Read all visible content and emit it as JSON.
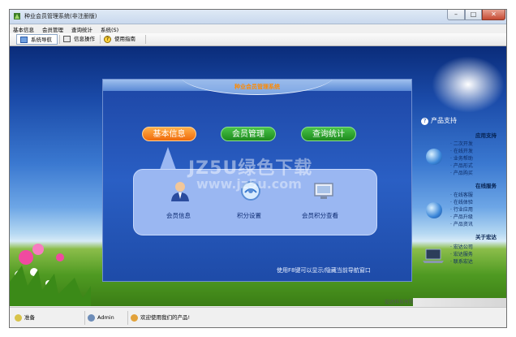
{
  "window": {
    "title": "种业会员管理系统(非注册版)",
    "controls": {
      "minimize": "–",
      "maximize": "□",
      "close": "✕"
    }
  },
  "menu": [
    "基本信息",
    "会员管理",
    "查询统计",
    "系统(S)"
  ],
  "toolbar": {
    "items": [
      {
        "label": "系统导航",
        "icon": "monitor-icon",
        "selected": true
      },
      {
        "label": "信息操作",
        "icon": "window-icon",
        "selected": false
      },
      {
        "label": "使用指南",
        "icon": "help-icon",
        "selected": false
      }
    ]
  },
  "nav_panel": {
    "title": "种业会员管理系统",
    "buttons": [
      {
        "label": "基本信息",
        "color": "#f07a10"
      },
      {
        "label": "会员管理",
        "color": "#28a028"
      },
      {
        "label": "查询统计",
        "color": "#28a028"
      }
    ],
    "sub_items": [
      {
        "label": "会员信息",
        "icon": "user-icon"
      },
      {
        "label": "积分设置",
        "icon": "globe-gear-icon"
      },
      {
        "label": "会员积分查看",
        "icon": "screen-icon"
      }
    ],
    "hint": "使用F8键可以显示/隐藏当前导航窗口"
  },
  "watermark": {
    "line1": "JZ5U绿色下载",
    "line2": "www.jz5u.com"
  },
  "right_panel": {
    "heading": "产品支持",
    "sections": [
      {
        "title": "应用支持",
        "items": [
          "二次开发",
          "在线开发",
          "业务帮助",
          "产品形式",
          "产品购买"
        ]
      },
      {
        "title": "在线服务",
        "items": [
          "在线客服",
          "在线体验",
          "行业应用",
          "产品升级",
          "产品资讯"
        ]
      },
      {
        "title": "关于宏达",
        "items": [
          "宏达公司",
          "宏达服务",
          "联系宏达"
        ]
      }
    ]
  },
  "statusbar": {
    "status": "准备",
    "user": "Admin",
    "welcome": "欢迎使用我们的产品!"
  },
  "tray_text": "宏达科技有限公司"
}
